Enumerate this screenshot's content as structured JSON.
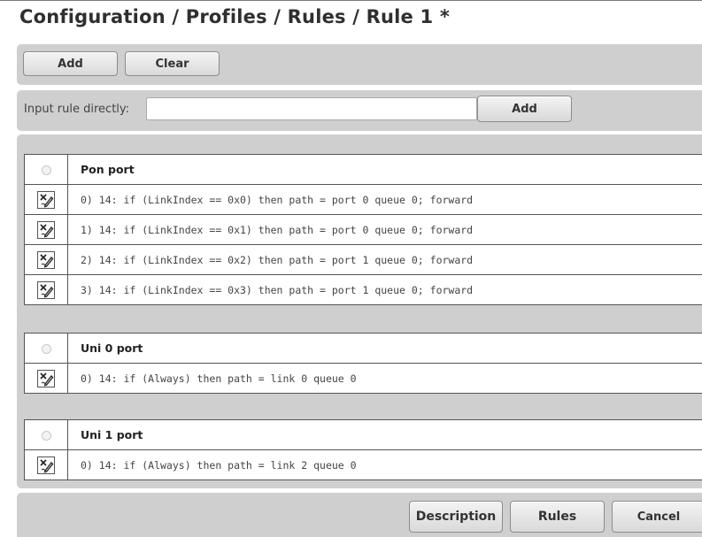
{
  "page": {
    "title": "Configuration / Profiles / Rules / Rule 1 *"
  },
  "toolbar": {
    "add_label": "Add",
    "clear_label": "Clear"
  },
  "input_bar": {
    "label": "Input rule directly:",
    "value": "",
    "add_label": "Add"
  },
  "groups": {
    "pon": {
      "header": "Pon port",
      "rules": [
        "0) 14: if (LinkIndex == 0x0) then path = port 0 queue 0; forward",
        "1) 14: if (LinkIndex == 0x1) then path = port 0 queue 0; forward",
        "2) 14: if (LinkIndex == 0x2) then path = port 1 queue 0; forward",
        "3) 14: if (LinkIndex == 0x3) then path = port 1 queue 0; forward"
      ]
    },
    "uni0": {
      "header": "Uni 0 port",
      "rules": [
        "0) 14: if (Always) then path = link 0 queue 0"
      ]
    },
    "uni1": {
      "header": "Uni 1 port",
      "rules": [
        "0) 14: if (Always) then path = link 2 queue 0"
      ]
    }
  },
  "footer": {
    "description_label": "Description",
    "rules_label": "Rules",
    "cancel_label": "Cancel"
  },
  "icons": {
    "row_action": "edit-icon",
    "group_select": "radio-button"
  },
  "colors": {
    "panel_bg": "#cfcfcf",
    "border": "#555555",
    "title": "#2f2f2f"
  }
}
